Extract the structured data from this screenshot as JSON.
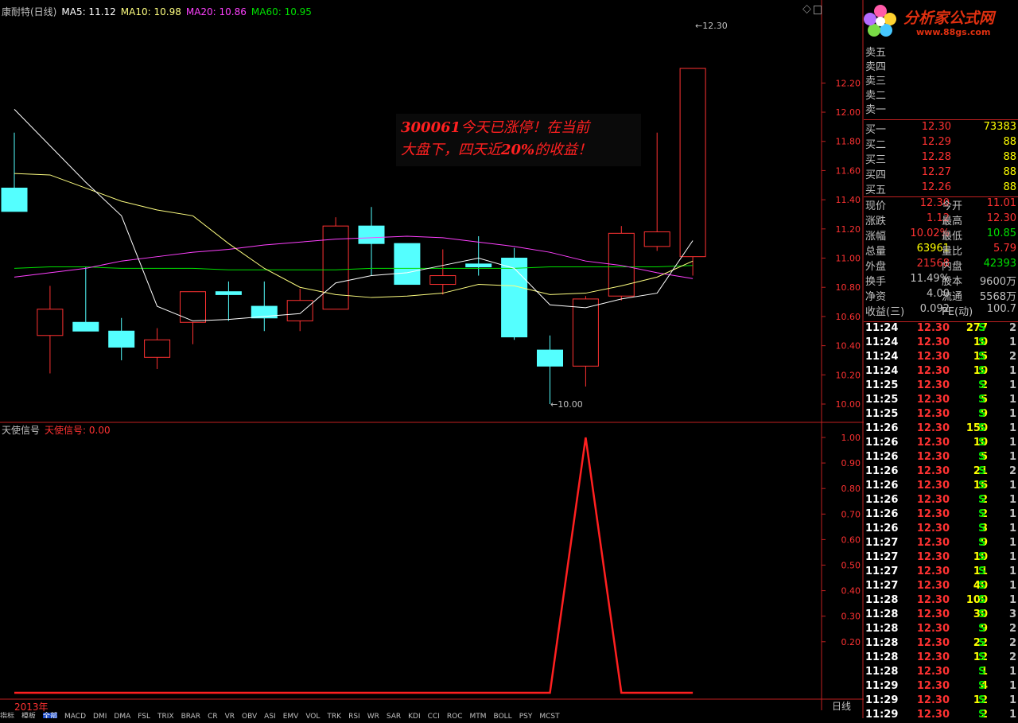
{
  "main_header": {
    "name": "康耐特(日线)",
    "ma5": "MA5: 11.12",
    "ma10": "MA10: 10.98",
    "ma20": "MA20: 10.86",
    "ma60": "MA60: 10.95"
  },
  "sub_header": {
    "name": "天使信号",
    "value": "天使信号: 0.00"
  },
  "annotation": {
    "line1_code": "300061",
    "line1_rest": "今天已涨停！在当前",
    "line2_a": "大盘下，四天近",
    "line2_b": "20%",
    "line2_c": "的收益！"
  },
  "high_marker": "12.30",
  "low_marker": "10.00",
  "year_label": "2013年",
  "period_label": "日线",
  "colors": {
    "up": "#ff3232",
    "down": "#54ffff",
    "ma5": "#ffffff",
    "ma10": "#ffff80",
    "ma20": "#ff40ff",
    "ma60": "#00e000",
    "signal": "#ff2020"
  },
  "chart_data": [
    {
      "type": "candlestick",
      "title": "康耐特(日线)",
      "ylim": [
        10.0,
        12.3
      ],
      "y_ticks": [
        "12.20",
        "12.00",
        "11.80",
        "11.60",
        "11.40",
        "11.20",
        "11.00",
        "10.80",
        "10.60",
        "10.40",
        "10.20",
        "10.00"
      ],
      "candles": [
        {
          "open": 11.48,
          "close": 11.32,
          "high": 11.86,
          "low": 11.32
        },
        {
          "open": 10.47,
          "close": 10.65,
          "high": 10.81,
          "low": 10.21
        },
        {
          "open": 10.56,
          "close": 10.5,
          "high": 10.94,
          "low": 10.5
        },
        {
          "open": 10.5,
          "close": 10.39,
          "high": 10.59,
          "low": 10.3
        },
        {
          "open": 10.32,
          "close": 10.44,
          "high": 10.52,
          "low": 10.24
        },
        {
          "open": 10.56,
          "close": 10.77,
          "high": 10.77,
          "low": 10.41
        },
        {
          "open": 10.77,
          "close": 10.75,
          "high": 10.84,
          "low": 10.57
        },
        {
          "open": 10.67,
          "close": 10.59,
          "high": 10.84,
          "low": 10.5
        },
        {
          "open": 10.57,
          "close": 10.71,
          "high": 10.79,
          "low": 10.5
        },
        {
          "open": 10.65,
          "close": 11.22,
          "high": 11.28,
          "low": 10.65
        },
        {
          "open": 11.22,
          "close": 11.1,
          "high": 11.35,
          "low": 10.88
        },
        {
          "open": 11.1,
          "close": 10.82,
          "high": 11.1,
          "low": 10.82
        },
        {
          "open": 10.82,
          "close": 10.88,
          "high": 11.06,
          "low": 10.75
        },
        {
          "open": 10.96,
          "close": 10.94,
          "high": 11.15,
          "low": 10.88
        },
        {
          "open": 11.0,
          "close": 10.46,
          "high": 11.07,
          "low": 10.44
        },
        {
          "open": 10.37,
          "close": 10.26,
          "high": 10.47,
          "low": 10.0
        },
        {
          "open": 10.26,
          "close": 10.72,
          "high": 10.74,
          "low": 10.12
        },
        {
          "open": 10.74,
          "close": 11.17,
          "high": 11.22,
          "low": 10.71
        },
        {
          "open": 11.08,
          "close": 11.18,
          "high": 11.86,
          "low": 11.05
        },
        {
          "open": 11.01,
          "close": 12.3,
          "high": 12.3,
          "low": 10.88
        }
      ],
      "ma5": [
        12.02,
        null,
        null,
        null,
        null,
        null,
        null,
        null,
        null,
        null,
        null,
        null,
        null,
        null,
        null,
        null,
        null,
        null,
        null,
        null
      ],
      "ma5_line": [
        12.02,
        11.77,
        11.52,
        11.29,
        10.67,
        10.57,
        10.58,
        10.6,
        10.62,
        10.83,
        10.88,
        10.9,
        10.95,
        11.0,
        10.93,
        10.68,
        10.66,
        10.72,
        10.76,
        11.12
      ],
      "ma10_line": [
        11.58,
        11.57,
        11.48,
        11.39,
        11.33,
        11.29,
        11.1,
        10.93,
        10.8,
        10.75,
        10.73,
        10.74,
        10.76,
        10.82,
        10.81,
        10.75,
        10.76,
        10.81,
        10.87,
        10.98
      ],
      "ma20_line": [
        10.87,
        10.9,
        10.93,
        10.98,
        11.01,
        11.04,
        11.06,
        11.09,
        11.11,
        11.13,
        11.14,
        11.15,
        11.14,
        11.11,
        11.08,
        11.04,
        10.98,
        10.95,
        10.9,
        10.86
      ],
      "ma60_line": [
        10.93,
        10.94,
        10.94,
        10.93,
        10.93,
        10.93,
        10.92,
        10.92,
        10.92,
        10.92,
        10.93,
        10.93,
        10.93,
        10.93,
        10.93,
        10.94,
        10.94,
        10.94,
        10.94,
        10.95
      ]
    },
    {
      "type": "line",
      "title": "天使信号",
      "ylim": [
        0,
        1.0
      ],
      "y_ticks": [
        "1.00",
        "0.90",
        "0.80",
        "0.70",
        "0.60",
        "0.50",
        "0.40",
        "0.30",
        "0.20"
      ],
      "values": [
        0,
        0,
        0,
        0,
        0,
        0,
        0,
        0,
        0,
        0,
        0,
        0,
        0,
        0,
        0,
        0,
        1,
        0,
        0,
        0
      ]
    }
  ],
  "quote_panel": {
    "sell_rows": [
      "卖五",
      "卖四",
      "卖三",
      "卖二",
      "卖一"
    ],
    "buy_rows": [
      {
        "label": "买一",
        "price": "12.30",
        "vol": "73383"
      },
      {
        "label": "买二",
        "price": "12.29",
        "vol": "88"
      },
      {
        "label": "买三",
        "price": "12.28",
        "vol": "88"
      },
      {
        "label": "买四",
        "price": "12.27",
        "vol": "88"
      },
      {
        "label": "买五",
        "price": "12.26",
        "vol": "88"
      }
    ],
    "stats": [
      {
        "l1": "现价",
        "v1": "12.30",
        "l2": "今开",
        "v2": "11.01",
        "c1": "#ff3232",
        "c2": "#ff3232"
      },
      {
        "l1": "涨跌",
        "v1": "1.12",
        "l2": "最高",
        "v2": "12.30",
        "c1": "#ff3232",
        "c2": "#ff3232"
      },
      {
        "l1": "涨幅",
        "v1": "10.02%",
        "l2": "最低",
        "v2": "10.85",
        "c1": "#ff3232",
        "c2": "#00e000"
      },
      {
        "l1": "总量",
        "v1": "63961",
        "l2": "量比",
        "v2": "5.79",
        "c1": "#ffff00",
        "c2": "#ff3232"
      },
      {
        "l1": "外盘",
        "v1": "21568",
        "l2": "内盘",
        "v2": "42393",
        "c1": "#ff3232",
        "c2": "#00e000"
      },
      {
        "l1": "换手",
        "v1": "11.49%",
        "l2": "股本",
        "v2": "9600万",
        "c1": "#c0c0c0",
        "c2": "#c0c0c0"
      },
      {
        "l1": "净资",
        "v1": "4.00",
        "l2": "流通",
        "v2": "5568万",
        "c1": "#c0c0c0",
        "c2": "#c0c0c0"
      },
      {
        "l1": "收益(三)",
        "v1": "0.092",
        "l2": "PE(动)",
        "v2": "100.7",
        "c1": "#c0c0c0",
        "c2": "#c0c0c0"
      }
    ],
    "ticks": [
      {
        "t": "11:24",
        "p": "12.30",
        "v": "277",
        "s": "S",
        "n": "2"
      },
      {
        "t": "11:24",
        "p": "12.30",
        "v": "10",
        "s": "S",
        "n": "1"
      },
      {
        "t": "11:24",
        "p": "12.30",
        "v": "15",
        "s": "S",
        "n": "2"
      },
      {
        "t": "11:24",
        "p": "12.30",
        "v": "10",
        "s": "S",
        "n": "1"
      },
      {
        "t": "11:25",
        "p": "12.30",
        "v": "2",
        "s": "S",
        "n": "1"
      },
      {
        "t": "11:25",
        "p": "12.30",
        "v": "5",
        "s": "S",
        "n": "1"
      },
      {
        "t": "11:25",
        "p": "12.30",
        "v": "9",
        "s": "S",
        "n": "1"
      },
      {
        "t": "11:26",
        "p": "12.30",
        "v": "150",
        "s": "S",
        "n": "1"
      },
      {
        "t": "11:26",
        "p": "12.30",
        "v": "10",
        "s": "S",
        "n": "1"
      },
      {
        "t": "11:26",
        "p": "12.30",
        "v": "5",
        "s": "S",
        "n": "1"
      },
      {
        "t": "11:26",
        "p": "12.30",
        "v": "21",
        "s": "S",
        "n": "2"
      },
      {
        "t": "11:26",
        "p": "12.30",
        "v": "16",
        "s": "S",
        "n": "1"
      },
      {
        "t": "11:26",
        "p": "12.30",
        "v": "2",
        "s": "S",
        "n": "1"
      },
      {
        "t": "11:26",
        "p": "12.30",
        "v": "2",
        "s": "S",
        "n": "1"
      },
      {
        "t": "11:26",
        "p": "12.30",
        "v": "3",
        "s": "S",
        "n": "1"
      },
      {
        "t": "11:27",
        "p": "12.30",
        "v": "9",
        "s": "S",
        "n": "1"
      },
      {
        "t": "11:27",
        "p": "12.30",
        "v": "10",
        "s": "S",
        "n": "1"
      },
      {
        "t": "11:27",
        "p": "12.30",
        "v": "11",
        "s": "S",
        "n": "1"
      },
      {
        "t": "11:27",
        "p": "12.30",
        "v": "40",
        "s": "S",
        "n": "1"
      },
      {
        "t": "11:28",
        "p": "12.30",
        "v": "100",
        "s": "S",
        "n": "1"
      },
      {
        "t": "11:28",
        "p": "12.30",
        "v": "30",
        "s": "S",
        "n": "3"
      },
      {
        "t": "11:28",
        "p": "12.30",
        "v": "9",
        "s": "S",
        "n": "2"
      },
      {
        "t": "11:28",
        "p": "12.30",
        "v": "22",
        "s": "S",
        "n": "2"
      },
      {
        "t": "11:28",
        "p": "12.30",
        "v": "12",
        "s": "S",
        "n": "2"
      },
      {
        "t": "11:28",
        "p": "12.30",
        "v": "1",
        "s": "S",
        "n": "1"
      },
      {
        "t": "11:29",
        "p": "12.30",
        "v": "4",
        "s": "S",
        "n": "1"
      },
      {
        "t": "11:29",
        "p": "12.30",
        "v": "12",
        "s": "S",
        "n": "1"
      },
      {
        "t": "11:29",
        "p": "12.30",
        "v": "2",
        "s": "S",
        "n": "1"
      }
    ]
  },
  "logo": {
    "brand": "分析家公式网",
    "url": "www.88gs.com"
  },
  "tabs": [
    "指标",
    "模板",
    "全部",
    "MACD",
    "DMI",
    "DMA",
    "FSL",
    "TRIX",
    "BRAR",
    "CR",
    "VR",
    "OBV",
    "ASI",
    "EMV",
    "VOL",
    "TRK",
    "RSI",
    "WR",
    "SAR",
    "KDJ",
    "CCI",
    "ROC",
    "MTM",
    "BOLL",
    "PSY",
    "MCST"
  ]
}
